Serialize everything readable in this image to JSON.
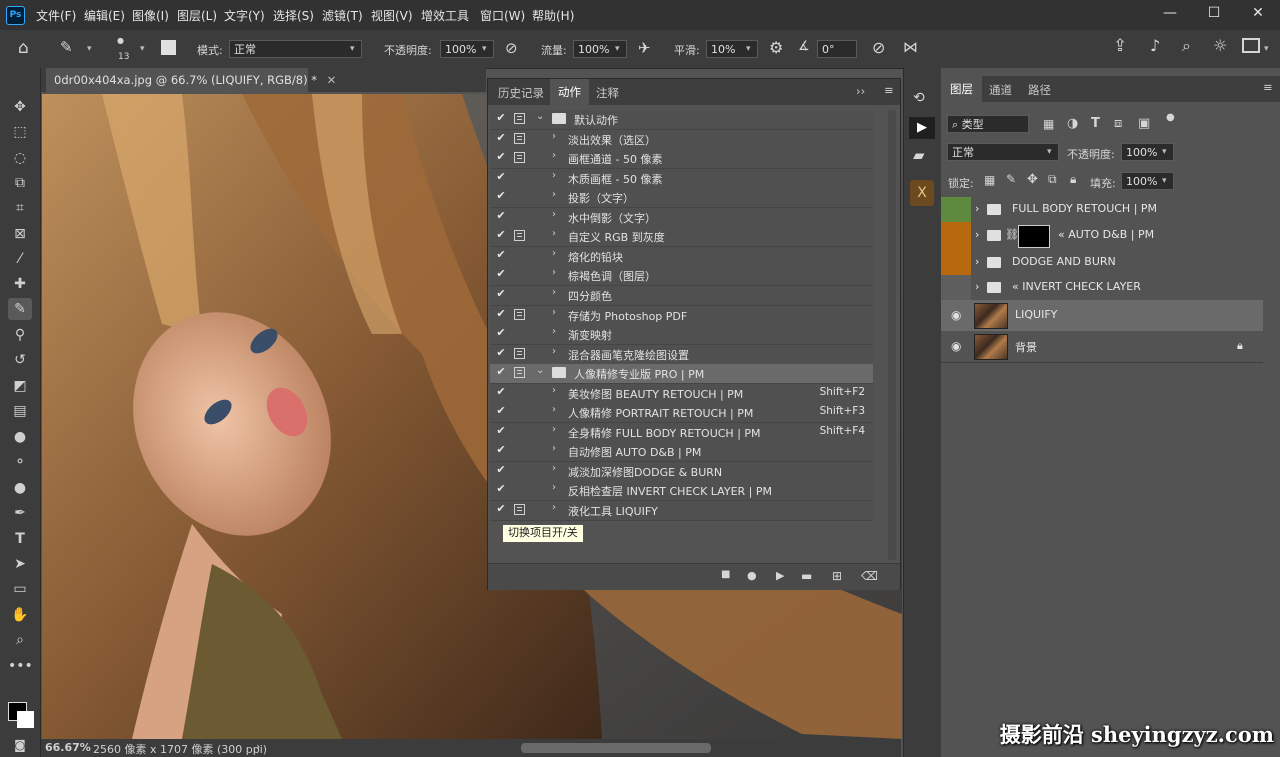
{
  "app": {
    "logo_text": "Ps"
  },
  "menu": [
    "文件(F)",
    "编辑(E)",
    "图像(I)",
    "图层(L)",
    "文字(Y)",
    "选择(S)",
    "滤镜(T)",
    "视图(V)",
    "增效工具",
    "窗口(W)",
    "帮助(H)"
  ],
  "window_controls": {
    "minimize": "—",
    "maximize": "☐",
    "close": "✕"
  },
  "options": {
    "brush_size": "13",
    "mode_label": "模式:",
    "mode_value": "正常",
    "opacity_label": "不透明度:",
    "opacity_value": "100%",
    "flow_label": "流量:",
    "flow_value": "100%",
    "smooth_label": "平滑:",
    "smooth_value": "10%",
    "angle_value": "0°"
  },
  "document": {
    "tab_title": "0dr00x404xa.jpg @ 66.7% (LIQUIFY, RGB/8) *",
    "zoom": "66.67%",
    "info": "2560 像素 x 1707 像素 (300 ppi)"
  },
  "actions_panel": {
    "tabs": [
      "历史记录",
      "动作",
      "注释"
    ],
    "active_tab": "动作",
    "rows": [
      {
        "label": "默认动作",
        "type": "set",
        "dialog": true,
        "expanded": true
      },
      {
        "label": "淡出效果（选区）",
        "dialog": true
      },
      {
        "label": "画框通道 - 50 像素",
        "dialog": true
      },
      {
        "label": "木质画框 - 50 像素",
        "dialog": false
      },
      {
        "label": "投影（文字）",
        "dialog": false
      },
      {
        "label": "水中倒影（文字）",
        "dialog": false
      },
      {
        "label": "自定义 RGB 到灰度",
        "dialog": true
      },
      {
        "label": "熔化的铅块",
        "dialog": false
      },
      {
        "label": "棕褐色调（图层）",
        "dialog": false
      },
      {
        "label": "四分颜色",
        "dialog": false
      },
      {
        "label": "存储为 Photoshop PDF",
        "dialog": true
      },
      {
        "label": "渐变映射",
        "dialog": false
      },
      {
        "label": "混合器画笔克隆绘图设置",
        "dialog": true
      },
      {
        "label": "人像精修专业版 PRO | PM",
        "type": "set",
        "dialog": true,
        "expanded": true,
        "selected": true
      },
      {
        "label": "美妆修图 BEAUTY RETOUCH | PM",
        "dialog": false,
        "key": "Shift+F2"
      },
      {
        "label": "人像精修 PORTRAIT RETOUCH | PM",
        "dialog": false,
        "key": "Shift+F3"
      },
      {
        "label": "全身精修 FULL BODY RETOUCH | PM",
        "dialog": false,
        "key": "Shift+F4"
      },
      {
        "label": "自动修图 AUTO D&B | PM",
        "dialog": false
      },
      {
        "label": "减淡加深修图DODGE & BURN",
        "dialog": false
      },
      {
        "label": "反相检查层 INVERT CHECK LAYER | PM",
        "dialog": false
      },
      {
        "label": "液化工具 LIQUIFY",
        "dialog": true
      }
    ],
    "tooltip": "切换项目开/关"
  },
  "layers_panel": {
    "tabs": [
      "图层",
      "通道",
      "路径"
    ],
    "active_tab": "图层",
    "filter_label": "类型",
    "blend_mode": "正常",
    "opacity_label": "不透明度:",
    "opacity_value": "100%",
    "lock_label": "锁定:",
    "fill_label": "填充:",
    "fill_value": "100%",
    "layers": [
      {
        "name": "FULL BODY RETOUCH | PM",
        "kind": "group",
        "color": "#5d8a3e"
      },
      {
        "name": "« AUTO D&B | PM",
        "kind": "group-mask",
        "color": "#b8690e"
      },
      {
        "name": "DODGE AND BURN",
        "kind": "group",
        "color": "#b8690e"
      },
      {
        "name": "« INVERT CHECK LAYER",
        "kind": "group",
        "color": "#5e5e5e"
      },
      {
        "name": "LIQUIFY",
        "kind": "pixel",
        "selected": true,
        "visible": true
      },
      {
        "name": "背景",
        "kind": "pixel",
        "visible": true,
        "locked": true
      }
    ]
  },
  "watermark": "摄影前沿 sheyingzyz.com"
}
